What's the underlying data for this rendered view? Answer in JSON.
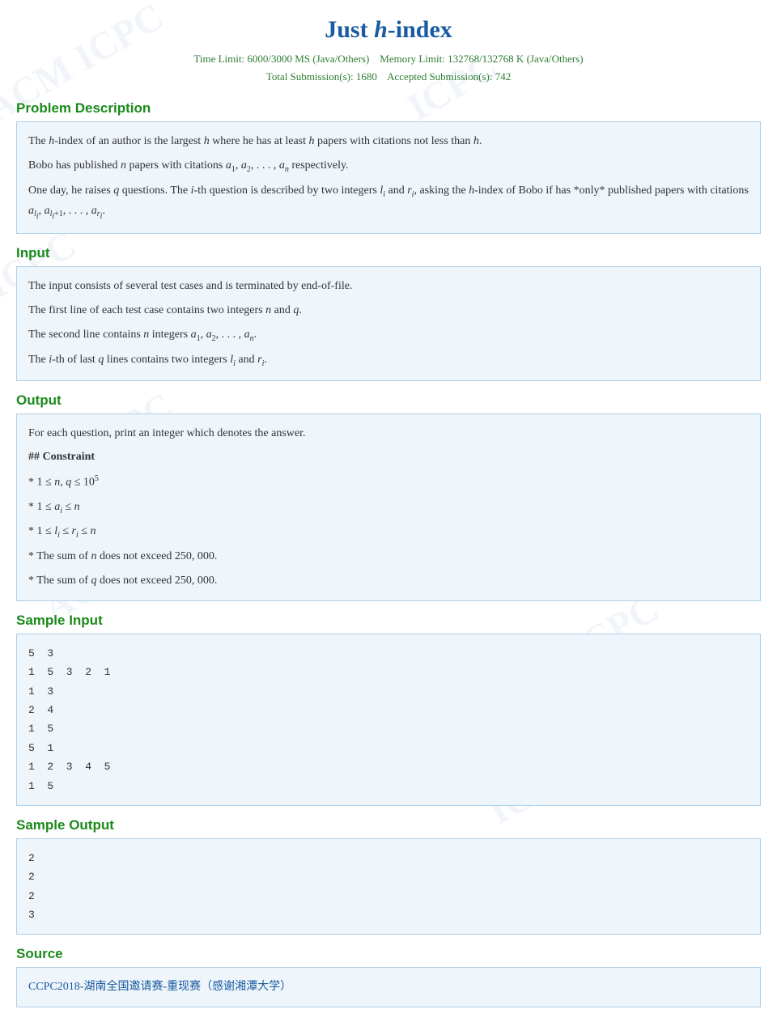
{
  "title": {
    "prefix": "Just ",
    "h": "h",
    "suffix": "-index"
  },
  "meta": {
    "time_limit": "Time Limit: 6000/3000 MS (Java/Others)",
    "memory_limit": "Memory Limit: 132768/132768 K (Java/Others)",
    "total_submissions": "Total Submission(s): 1680",
    "accepted": "Accepted Submission(s): 742"
  },
  "sections": {
    "problem_description": {
      "header": "Problem Description",
      "lines": [
        "The h-index of an author is the largest h where he has at least h papers with citations not less than h.",
        "Bobo has published n papers with citations a₁, a₂, ..., aₙ respectively.",
        "One day, he raises q questions. The i-th question is described by two integers lᵢ and rᵢ, asking the h-index of Bobo if has *only* published papers with citations aₗᵢ, aₗᵢ₊₁, ..., aᵣᵢ."
      ]
    },
    "input": {
      "header": "Input",
      "lines": [
        "The input consists of several test cases and is terminated by end-of-file.",
        "The first line of each test case contains two integers n and q.",
        "The second line contains n integers a₁, a₂, ..., aₙ.",
        "The i-th of last q lines contains two integers lᵢ and rᵢ."
      ]
    },
    "output": {
      "header": "Output",
      "main": "For each question, print an integer which denotes the answer.",
      "constraint_header": "## Constraint",
      "constraints": [
        "* 1 ≤ n, q ≤ 10⁵",
        "* 1 ≤ aᵢ ≤ n",
        "* 1 ≤ lᵢ ≤ rᵢ ≤ n",
        "* The sum of n does not exceed 250, 000.",
        "* The sum of q does not exceed 250, 000."
      ]
    },
    "sample_input": {
      "header": "Sample Input",
      "content": "5  3\n1  5  3  2  1\n1  3\n2  4\n1  5\n5  1\n1  2  3  4  5\n1  5"
    },
    "sample_output": {
      "header": "Sample Output",
      "content": "2\n2\n2\n3"
    },
    "source": {
      "header": "Source",
      "link": "CCPC2018-湖南全国邀请赛-重现赛（感谢湘潭大学）"
    }
  }
}
